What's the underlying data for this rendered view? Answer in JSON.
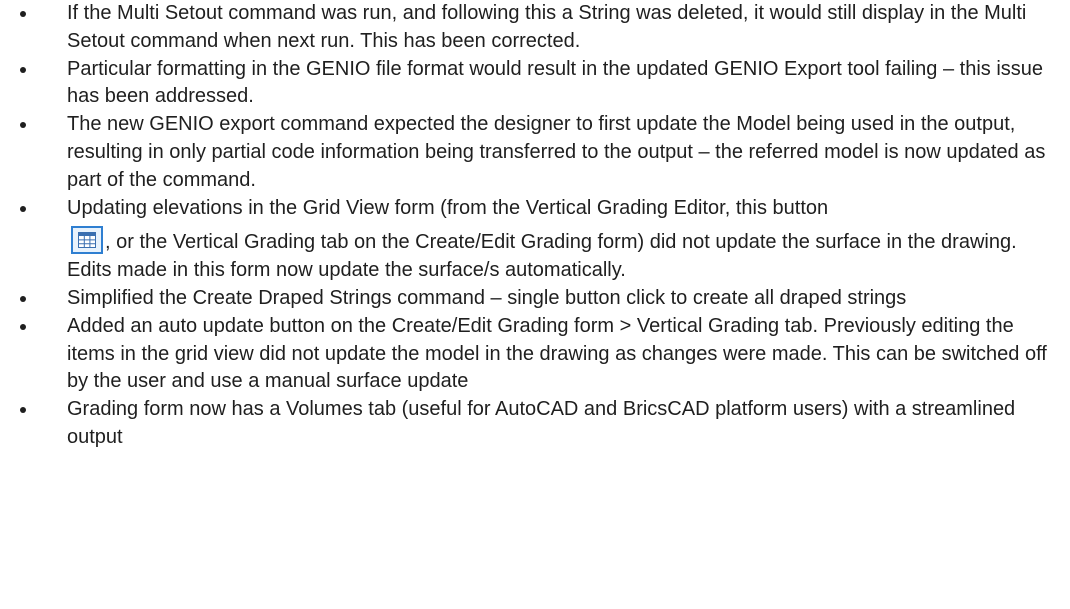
{
  "items": [
    {
      "text": "If the Multi Setout command was run, and following this a String was deleted, it would still display in the Multi Setout command when next run.  This has been corrected."
    },
    {
      "text": "Particular formatting in the GENIO file format would result in the updated GENIO Export tool failing – this issue has been addressed."
    },
    {
      "text": "The new GENIO export command expected the designer to first update the Model being used in the output, resulting in only partial code information being transferred to the output  – the referred model is now updated as part of the command."
    },
    {
      "text_before": "Updating elevations in the Grid View form (from the Vertical Grading Editor, this button",
      "text_after": ", or the Vertical Grading tab on the Create/Edit Grading form) did not update the surface in the drawing.  Edits made in this form now update the surface/s automatically.",
      "icon": "grid-view-icon"
    },
    {
      "text": "Simplified the Create Draped Strings command – single button click to create all draped strings"
    },
    {
      "text": "Added an auto update button on the Create/Edit Grading form > Vertical Grading tab. Previously editing the items in the grid view did not update the model in the drawing as changes were made.  This can be switched off by the user and use a manual surface update"
    },
    {
      "text": "Grading form now has a Volumes tab (useful for AutoCAD and BricsCAD platform users) with a streamlined output"
    }
  ],
  "colors": {
    "text": "#1f1f1f",
    "icon_border": "#2f7fd1",
    "icon_fill": "#e8f2fc"
  }
}
